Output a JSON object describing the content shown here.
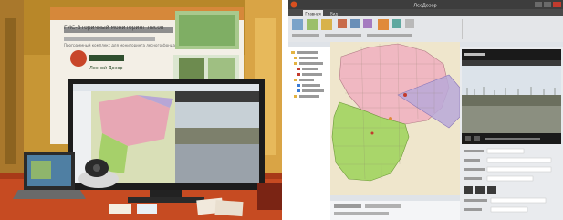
{
  "photo": {
    "booth_banner_title": "ГИС-Вторичный мониторинг лесов",
    "booth_banner_subtitle": "Программный комплекс для мониторинга лесного фонда",
    "booth_logo_text": "Лесной Дозор",
    "colors": {
      "banner_orange": "#d6883a",
      "table_cloth": "#c64b22",
      "monitor_frame": "#1c1c1c"
    }
  },
  "app": {
    "window_title": "ЛесДозор",
    "ribbon_tabs": [
      "Главная",
      "Вид"
    ],
    "colors": {
      "map_background": "#efe6cc",
      "region_pink": "#f0b8c2",
      "region_green": "#a9d66a",
      "region_purple": "#b8a8d8",
      "video_sky": "#dce3ea",
      "video_forest": "#6b6f5e",
      "dark_bar": "#1a1a1a"
    }
  }
}
